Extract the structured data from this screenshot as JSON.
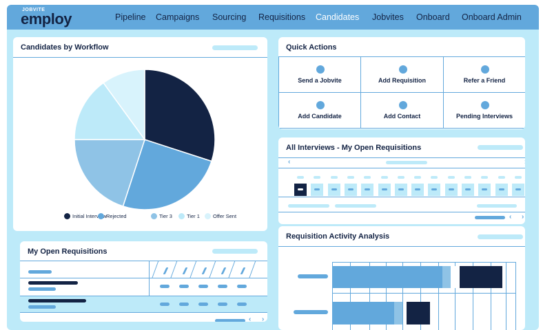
{
  "app": {
    "logo_small": "JOBVITE",
    "logo_big": "employ"
  },
  "nav": {
    "items": [
      "Pipeline",
      "Campaigns",
      "Sourcing",
      "Requisitions",
      "Candidates",
      "Jobvites",
      "Onboard",
      "Onboard Admin"
    ],
    "active": "Candidates"
  },
  "candidates_by_workflow": {
    "title": "Candidates by Workflow"
  },
  "chart_data": {
    "type": "pie",
    "labels": [
      "Initial Interview",
      "Rejected",
      "Tier 3",
      "Tier 1",
      "Offer Sent"
    ],
    "values": [
      30,
      25,
      20,
      15,
      10
    ],
    "colors": [
      "#132344",
      "#62a8dc",
      "#8fc3e6",
      "#bdeaf9",
      "#d8f3fc"
    ],
    "legend_position": "bottom"
  },
  "quick_actions": {
    "title": "Quick Actions",
    "items": [
      "Send a Jobvite",
      "Add Requisition",
      "Refer a Friend",
      "Add Candidate",
      "Add Contact",
      "Pending Interviews"
    ]
  },
  "all_interviews": {
    "title": "All Interviews - My Open Requisitions"
  },
  "my_open_requisitions": {
    "title": "My Open Requisitions"
  },
  "activity_analysis": {
    "title": "Requisition Activity Analysis"
  },
  "icons": {
    "prev": "chevron-left-icon",
    "next": "chevron-right-icon"
  },
  "chevrons": {
    "left": "‹",
    "right": "›"
  }
}
